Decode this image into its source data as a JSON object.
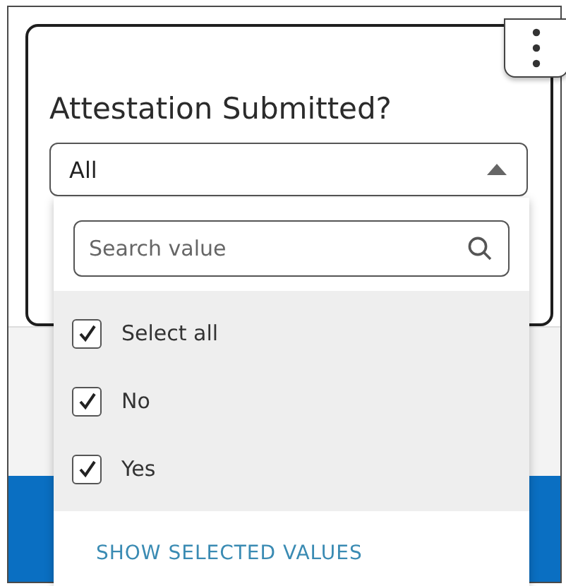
{
  "card": {
    "title": "Attestation Submitted?"
  },
  "dropdown": {
    "value": "All",
    "expanded": true
  },
  "popup": {
    "search": {
      "placeholder": "Search value"
    },
    "options": [
      {
        "label": "Select all",
        "checked": true
      },
      {
        "label": "No",
        "checked": true
      },
      {
        "label": "Yes",
        "checked": true
      }
    ],
    "link": "SHOW SELECTED VALUES"
  }
}
